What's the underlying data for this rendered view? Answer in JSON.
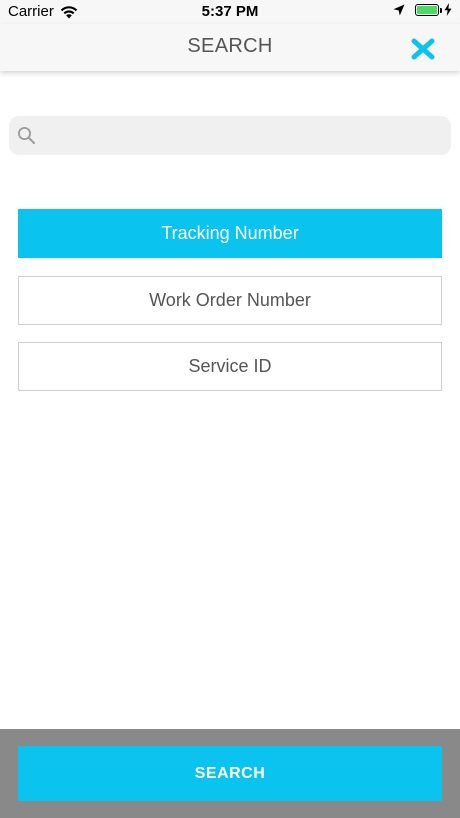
{
  "status_bar": {
    "carrier": "Carrier",
    "time": "5:37 PM",
    "battery_color": "#4cd964"
  },
  "nav": {
    "title": "SEARCH",
    "close_icon": "close-x-icon",
    "close_color": "#0bc3ef"
  },
  "search": {
    "value": "",
    "placeholder": "",
    "icon": "search-icon"
  },
  "options": [
    {
      "label": "Tracking Number",
      "selected": true
    },
    {
      "label": "Work Order Number",
      "selected": false
    },
    {
      "label": "Service ID",
      "selected": false
    }
  ],
  "footer": {
    "search_label": "SEARCH"
  },
  "colors": {
    "accent": "#0bc3ef",
    "footer_bg": "#898989",
    "text": "#555555"
  }
}
